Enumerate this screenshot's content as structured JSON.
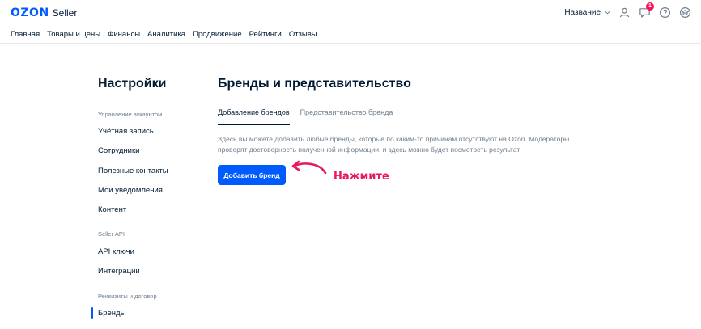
{
  "brand": {
    "logo": "OZON",
    "product": "Seller"
  },
  "nav": [
    "Главная",
    "Товары и цены",
    "Финансы",
    "Аналитика",
    "Продвижение",
    "Рейтинги",
    "Отзывы"
  ],
  "header_right": {
    "company_name": "Название",
    "notifications_count": "1"
  },
  "settings": {
    "title": "Настройки",
    "sections": {
      "account_label": "Управление аккаунтом",
      "account_items": [
        "Учётная запись",
        "Сотрудники",
        "Полезные контакты",
        "Мои уведомления",
        "Контент"
      ],
      "api_label": "Seller API",
      "api_items": [
        "API ключи",
        "Интеграции"
      ],
      "requisites_label": "Реквизиты и договор",
      "requisites_items": [
        "Бренды"
      ]
    }
  },
  "main": {
    "title": "Бренды и представительство",
    "tabs": [
      "Добавление брендов",
      "Представительство бренда"
    ],
    "active_tab": "Добавление брендов",
    "description": "Здесь вы можете добавить любые бренды, которые по каким-то причинам отсутствуют на Ozon. Модераторы проверят достоверность полученной информации, и здесь можно будет посмотреть результат.",
    "add_button": "Добавить бренд",
    "hint": "Нажмите"
  },
  "colors": {
    "accent": "#005bff",
    "hint": "#e8185b",
    "badge": "#f91155",
    "muted": "#707f8d",
    "text": "#001a34"
  }
}
